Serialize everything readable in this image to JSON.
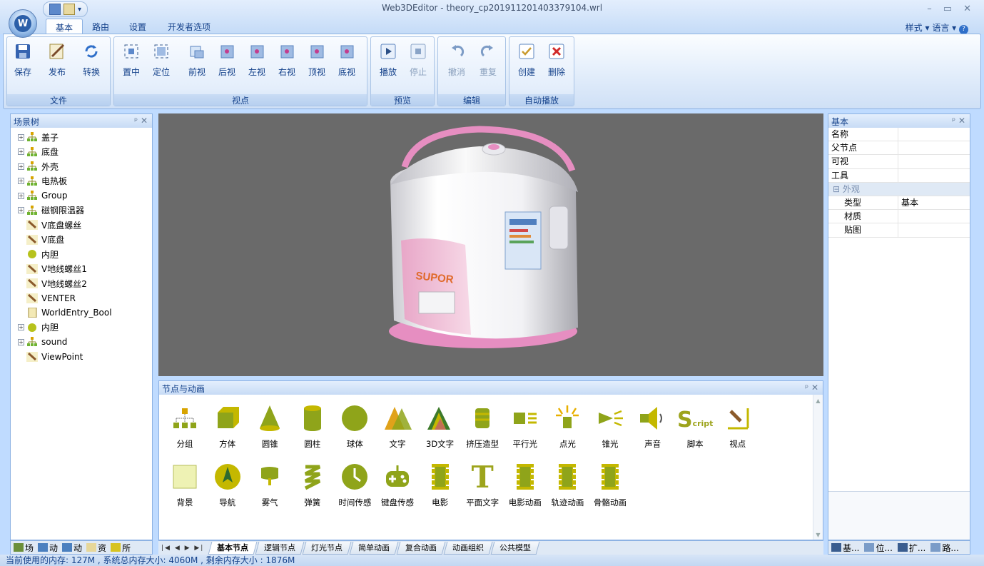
{
  "window": {
    "title": "Web3DEditor - theory_cp201911201403379104.wrl"
  },
  "tabs": [
    {
      "label": "基本"
    },
    {
      "label": "路由"
    },
    {
      "label": "设置"
    },
    {
      "label": "开发者选项"
    }
  ],
  "ribbon_right": {
    "style": "样式",
    "lang": "语言"
  },
  "groups": {
    "file": "文件",
    "view": "视点",
    "preview": "预览",
    "edit": "编辑",
    "auto": "自动播放"
  },
  "buttons": {
    "save": "保存",
    "publish": "发布",
    "convert": "转换",
    "center": "置中",
    "locate": "定位",
    "front": "前视",
    "back": "后视",
    "left": "左视",
    "right": "右视",
    "top": "顶视",
    "bottom": "底视",
    "play": "播放",
    "stop": "停止",
    "undo": "撤消",
    "redo": "重复",
    "create": "创建",
    "delete": "删除"
  },
  "scene_tree": {
    "title": "场景树",
    "items": [
      {
        "label": "盖子",
        "kind": "group"
      },
      {
        "label": "底盘",
        "kind": "group"
      },
      {
        "label": "外壳",
        "kind": "group"
      },
      {
        "label": "电热板",
        "kind": "group"
      },
      {
        "label": "Group",
        "kind": "group"
      },
      {
        "label": "磁钢限温器",
        "kind": "group"
      },
      {
        "label": "V底盘螺丝",
        "kind": "view"
      },
      {
        "label": "V底盘",
        "kind": "view"
      },
      {
        "label": "内胆",
        "kind": "sphere"
      },
      {
        "label": "V地线螺丝1",
        "kind": "view"
      },
      {
        "label": "V地线螺丝2",
        "kind": "view"
      },
      {
        "label": "VENTER",
        "kind": "view"
      },
      {
        "label": "WorldEntry_Bool",
        "kind": "doc"
      },
      {
        "label": "内胆",
        "kind": "sphere"
      },
      {
        "label": "sound",
        "kind": "group"
      },
      {
        "label": "ViewPoint",
        "kind": "view"
      }
    ]
  },
  "viewport": {
    "brand_text": "SUPOR"
  },
  "library": {
    "title": "节点与动画",
    "row1": [
      "分组",
      "方体",
      "圆锥",
      "圆柱",
      "球体",
      "文字",
      "3D文字",
      "挤压造型",
      "平行光",
      "点光",
      "锥光",
      "声音",
      "脚本",
      "视点"
    ],
    "row2": [
      "背景",
      "导航",
      "雾气",
      "弹簧",
      "时间传感",
      "键盘传感",
      "电影",
      "平面文字",
      "电影动画",
      "轨迹动画",
      "骨骼动画"
    ],
    "script_big": "S",
    "script_small": "cript",
    "text_glyph": "T",
    "tabs": [
      "基本节点",
      "逻辑节点",
      "灯光节点",
      "简单动画",
      "复合动画",
      "动画组织",
      "公共模型"
    ]
  },
  "left_bottom_tabs": [
    "场",
    "动",
    "动",
    "资",
    "所"
  ],
  "properties": {
    "title": "基本",
    "rows": [
      {
        "key": "名称",
        "value": ""
      },
      {
        "key": "父节点",
        "value": ""
      },
      {
        "key": "可视",
        "value": ""
      },
      {
        "key": "工具",
        "value": ""
      }
    ],
    "section": "外观",
    "sub_rows": [
      {
        "key": "类型",
        "value": "基本"
      },
      {
        "key": "材质",
        "value": ""
      },
      {
        "key": "贴图",
        "value": ""
      }
    ]
  },
  "right_bottom_tabs": [
    "基...",
    "位...",
    "扩...",
    "路..."
  ],
  "status": "当前使用的内存: 127M , 系统总内存大小: 4060M , 剩余内存大小 : 1876M",
  "colors": {
    "accent": "#15428b",
    "ribbon_bg": "#dfebfa",
    "viewport": "#6a6a6a",
    "cooker_pink": "#e68ec1"
  }
}
